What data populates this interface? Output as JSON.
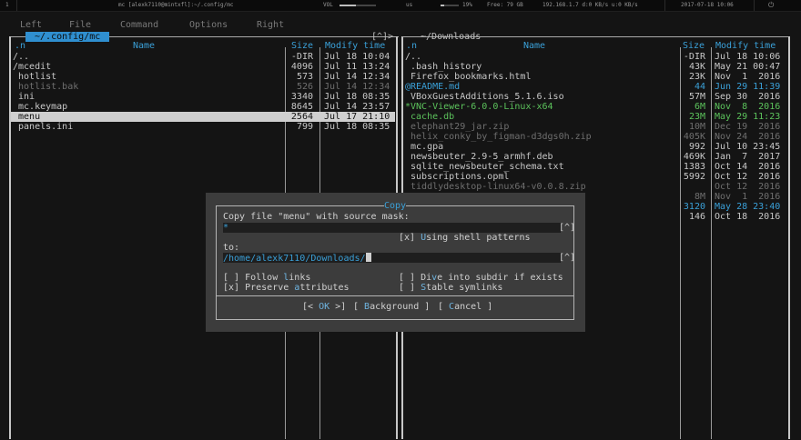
{
  "topbar": {
    "workspace": "1",
    "window_title": "mc [alexk7110@mintxfl]:~/.config/mc",
    "vol_label": "VOL",
    "vol_value": "us",
    "ram_percent": "19%",
    "free_label": "Free: 79 GB",
    "network": "192.168.1.7  d:0 KB/s  u:0 KB/s",
    "datetime": "2017-07-18 10:06",
    "vol_level": 0.45,
    "ram_level": 0.2
  },
  "menu": [
    "Left",
    "File",
    "Command",
    "Options",
    "Right"
  ],
  "left_panel": {
    "path": " ~/.config/mc ",
    "hist": "[^]>",
    "hdr_n": ".n",
    "hdr_name": "Name",
    "hdr_size": "Size",
    "hdr_mod": "Modify time",
    "rows": [
      {
        "name": "/..",
        "size": "-DIR",
        "mod": "Jul 18 10:04",
        "style": "normal"
      },
      {
        "name": "/mcedit",
        "size": "4096",
        "mod": "Jul 11 13:24",
        "style": "normal"
      },
      {
        "name": " hotlist",
        "size": "573",
        "mod": "Jul 14 12:34",
        "style": "normal"
      },
      {
        "name": " hotlist.bak",
        "size": "526",
        "mod": "Jul 14 12:34",
        "style": "dim"
      },
      {
        "name": " ini",
        "size": "3340",
        "mod": "Jul 18 08:35",
        "style": "normal"
      },
      {
        "name": " mc.keymap",
        "size": "8645",
        "mod": "Jul 14 23:57",
        "style": "normal"
      },
      {
        "name": " menu",
        "size": "2564",
        "mod": "Jul 17 21:10",
        "style": "selected"
      },
      {
        "name": " panels.ini",
        "size": "799",
        "mod": "Jul 18 08:35",
        "style": "normal"
      }
    ]
  },
  "right_panel": {
    "path": " ~/Downloads ",
    "hist": "[^]>",
    "hdr_n": ".n",
    "hdr_name": "Name",
    "hdr_size": "Size",
    "hdr_mod": "Modify time",
    "rows": [
      {
        "name": "/..",
        "size": "-DIR",
        "mod": "Jul 18 10:06",
        "style": "normal"
      },
      {
        "name": " .bash_history",
        "size": "43K",
        "mod": "May 21 00:47",
        "style": "normal"
      },
      {
        "name": " Firefox_bookmarks.html",
        "size": "23K",
        "mod": "Nov  1  2016",
        "style": "normal"
      },
      {
        "name": "@README.md",
        "size": "44",
        "mod": "Jun 29 11:39",
        "style": "link"
      },
      {
        "name": " VBoxGuestAdditions_5.1.6.iso",
        "size": "57M",
        "mod": "Sep 30  2016",
        "style": "normal"
      },
      {
        "name": "*VNC-Viewer-6.0.0-Linux-x64",
        "size": "6M",
        "mod": "Nov  8  2016",
        "style": "exec"
      },
      {
        "name": " cache.db",
        "size": "23M",
        "mod": "May 29 11:23",
        "style": "exec"
      },
      {
        "name": " elephant29_jar.zip",
        "size": "10M",
        "mod": "Dec 19  2016",
        "style": "dim"
      },
      {
        "name": " helix_conky_by_figman-d3dgs0h.zip",
        "size": "405K",
        "mod": "Nov 24  2016",
        "style": "dim"
      },
      {
        "name": " mc.gpa",
        "size": "992",
        "mod": "Jul 10 23:45",
        "style": "normal"
      },
      {
        "name": " newsbeuter_2.9-5_armhf.deb",
        "size": "469K",
        "mod": "Jan  7  2017",
        "style": "normal"
      },
      {
        "name": " sqlite_newsbeuter_schema.txt",
        "size": "1383",
        "mod": "Oct 14  2016",
        "style": "normal"
      },
      {
        "name": " subscriptions.opml",
        "size": "5992",
        "mod": "Oct 12  2016",
        "style": "normal"
      },
      {
        "name": " tiddlydesktop-linux64-v0.0.8.zip",
        "size": "",
        "mod": "Oct 12  2016",
        "style": "dim"
      },
      {
        "name": "",
        "size": "8M",
        "mod": "Nov  1  2016",
        "style": "dim"
      },
      {
        "name": "",
        "size": "3120",
        "mod": "May 28 23:40",
        "style": "link"
      },
      {
        "name": "",
        "size": "146",
        "mod": "Oct 18  2016",
        "style": "normal"
      }
    ]
  },
  "dialog": {
    "title": " Copy ",
    "source_label": "Copy file \"menu\" with source mask:",
    "source_value": "*",
    "hist_btn": "[^]",
    "shell_check": "[x]",
    "shell_label_hk": "U",
    "shell_label_rest": "sing shell patterns",
    "to_label": "to:",
    "dest_value": "/home/alexk7110/Downloads/",
    "opt1_box": "[ ]",
    "opt1_pre": "Follow ",
    "opt1_hk": "l",
    "opt1_post": "inks",
    "opt2_box": "[x]",
    "opt2_pre": "Preserve ",
    "opt2_hk": "a",
    "opt2_post": "ttributes",
    "opt3_box": "[ ]",
    "opt3_pre": "Di",
    "opt3_hk": "v",
    "opt3_post": "e into subdir if exists",
    "opt4_box": "[ ]",
    "opt4_hk": "S",
    "opt4_post": "table symlinks",
    "btn_ok_pre": "[< ",
    "btn_ok_hk": "O",
    "btn_ok_rest": "K",
    "btn_ok_post": " >]",
    "btn_bg_pre": "[ ",
    "btn_bg_hk": "B",
    "btn_bg_rest": "ackground",
    "btn_bg_post": " ]",
    "btn_cancel_pre": "[ ",
    "btn_cancel_hk": "C",
    "btn_cancel_rest": "ancel",
    "btn_cancel_post": " ]"
  },
  "colors": {
    "header": "#3aa0d8",
    "selected_bg": "#cfcfcf",
    "selected_fg": "#101010",
    "link": "#3aa0d8",
    "exec": "#5cc35c",
    "dim": "#6f6f6f",
    "normal": "#c8c8c8"
  }
}
